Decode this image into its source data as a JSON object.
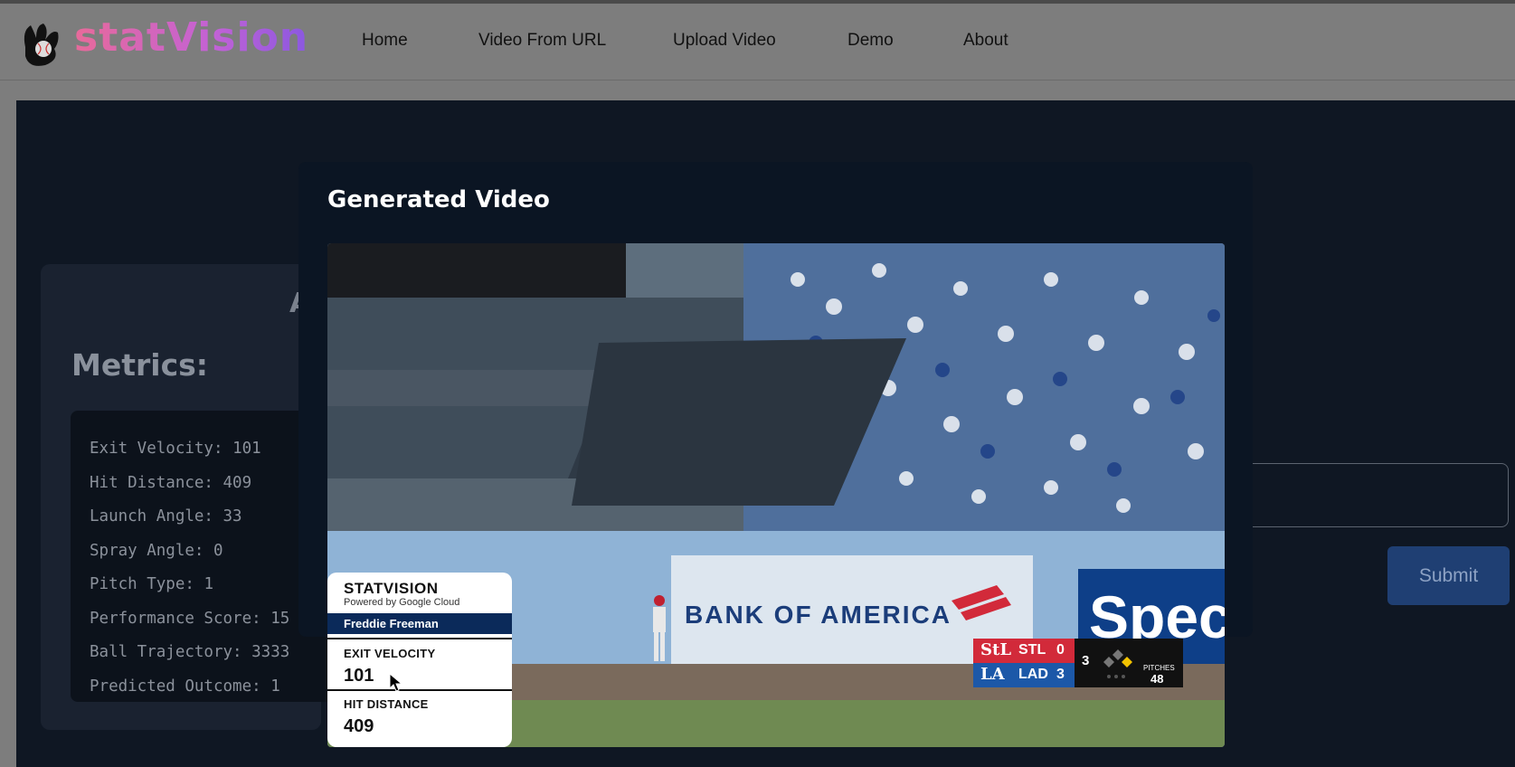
{
  "navbar": {
    "brand": "statVision",
    "links": [
      "Home",
      "Video From URL",
      "Upload Video",
      "Demo",
      "About"
    ]
  },
  "metrics": {
    "heading_fragment": "A",
    "title": "Metrics:",
    "lines": [
      {
        "label": "Exit Velocity:",
        "value": "101"
      },
      {
        "label": "Hit Distance:",
        "value": "409"
      },
      {
        "label": "Launch Angle:",
        "value": "33"
      },
      {
        "label": "Spray Angle:",
        "value": "0"
      },
      {
        "label": "Pitch Type:",
        "value": "1"
      },
      {
        "label": "Performance Score:",
        "value": "15"
      },
      {
        "label": "Ball Trajectory:",
        "value": "3333"
      },
      {
        "label": "Predicted Outcome:",
        "value": "1"
      }
    ]
  },
  "form": {
    "submit_label": "Submit"
  },
  "modal": {
    "title": "Generated Video"
  },
  "video": {
    "overlay": {
      "brand": "STATVISION",
      "powered_by": "Powered by Google Cloud",
      "player": "Freddie Freeman",
      "exit_velocity_label": "EXIT VELOCITY",
      "exit_velocity": "101",
      "hit_distance_label": "HIT DISTANCE",
      "hit_distance": "409"
    },
    "banner_text": "BANK OF AMERICA",
    "sponsor_fragment": "Spec",
    "scorebug": {
      "away": {
        "abbr": "STL",
        "score": "0",
        "logo": "StL"
      },
      "home": {
        "abbr": "LAD",
        "score": "3",
        "logo": "LA"
      },
      "inning": "3",
      "pitches_label": "PITCHES",
      "pitches": "48"
    }
  },
  "colors": {
    "navbar_bg": "#7d7d7d",
    "page_bg": "#0f1723",
    "modal_bg": "#0b1523",
    "brand_gradient_start": "#e86a9a",
    "brand_gradient_end": "#8a58e0",
    "submit_bg": "#1f3f73",
    "player_bar": "#0b2a5a",
    "stl_red": "#d22a3a",
    "lad_blue": "#1c58a8"
  }
}
